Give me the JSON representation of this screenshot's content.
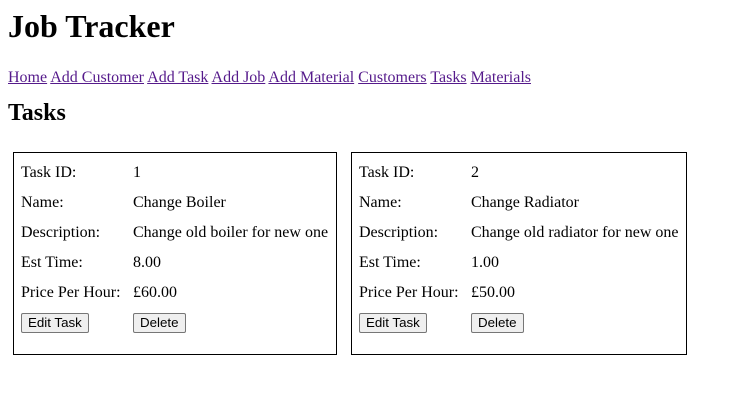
{
  "app": {
    "title": "Job Tracker"
  },
  "nav": {
    "links": [
      {
        "label": "Home"
      },
      {
        "label": "Add Customer"
      },
      {
        "label": "Add Task"
      },
      {
        "label": "Add Job"
      },
      {
        "label": "Add Material"
      },
      {
        "label": "Customers"
      },
      {
        "label": "Tasks"
      },
      {
        "label": "Materials"
      }
    ],
    "link_color": "#551a8b"
  },
  "page": {
    "heading": "Tasks"
  },
  "labels": {
    "task_id": "Task ID:",
    "name": "Name:",
    "description": "Description:",
    "est_time": "Est Time:",
    "price_per_hour": "Price Per Hour:",
    "edit_button": "Edit Task",
    "delete_button": "Delete"
  },
  "tasks": [
    {
      "id": "1",
      "name": "Change Boiler",
      "description": "Change old boiler for new one",
      "est_time": "8.00",
      "price_per_hour": "£60.00"
    },
    {
      "id": "2",
      "name": "Change Radiator",
      "description": "Change old radiator for new one",
      "est_time": "1.00",
      "price_per_hour": "£50.00"
    }
  ]
}
